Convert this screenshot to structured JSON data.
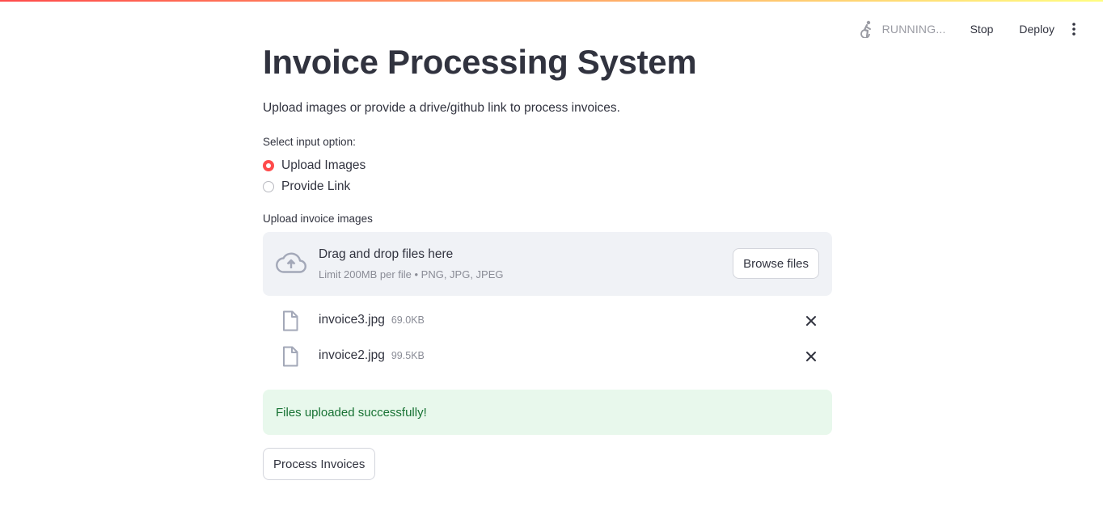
{
  "header": {
    "status_text": "RUNNING...",
    "status_icon": "running-person-icon",
    "stop_label": "Stop",
    "deploy_label": "Deploy",
    "menu_icon": "kebab-menu-icon"
  },
  "main": {
    "title": "Invoice Processing System",
    "subtitle": "Upload images or provide a drive/github link to process invoices.",
    "input_option": {
      "label": "Select input option:",
      "options": [
        {
          "label": "Upload Images",
          "selected": true
        },
        {
          "label": "Provide Link",
          "selected": false
        }
      ]
    },
    "uploader": {
      "label": "Upload invoice images",
      "drop_title": "Drag and drop files here",
      "limit_text": "Limit 200MB per file • PNG, JPG, JPEG",
      "browse_label": "Browse files",
      "icon": "cloud-upload-icon"
    },
    "files": [
      {
        "name": "invoice3.jpg",
        "size": "69.0KB"
      },
      {
        "name": "invoice2.jpg",
        "size": "99.5KB"
      }
    ],
    "success_message": "Files uploaded successfully!",
    "process_button_label": "Process Invoices"
  },
  "colors": {
    "accent": "#ff4b4b",
    "text": "#31333f",
    "muted": "#8a8c96",
    "dropzone_bg": "#f0f2f6",
    "success_bg": "#e8f8ec",
    "success_text": "#177233"
  }
}
